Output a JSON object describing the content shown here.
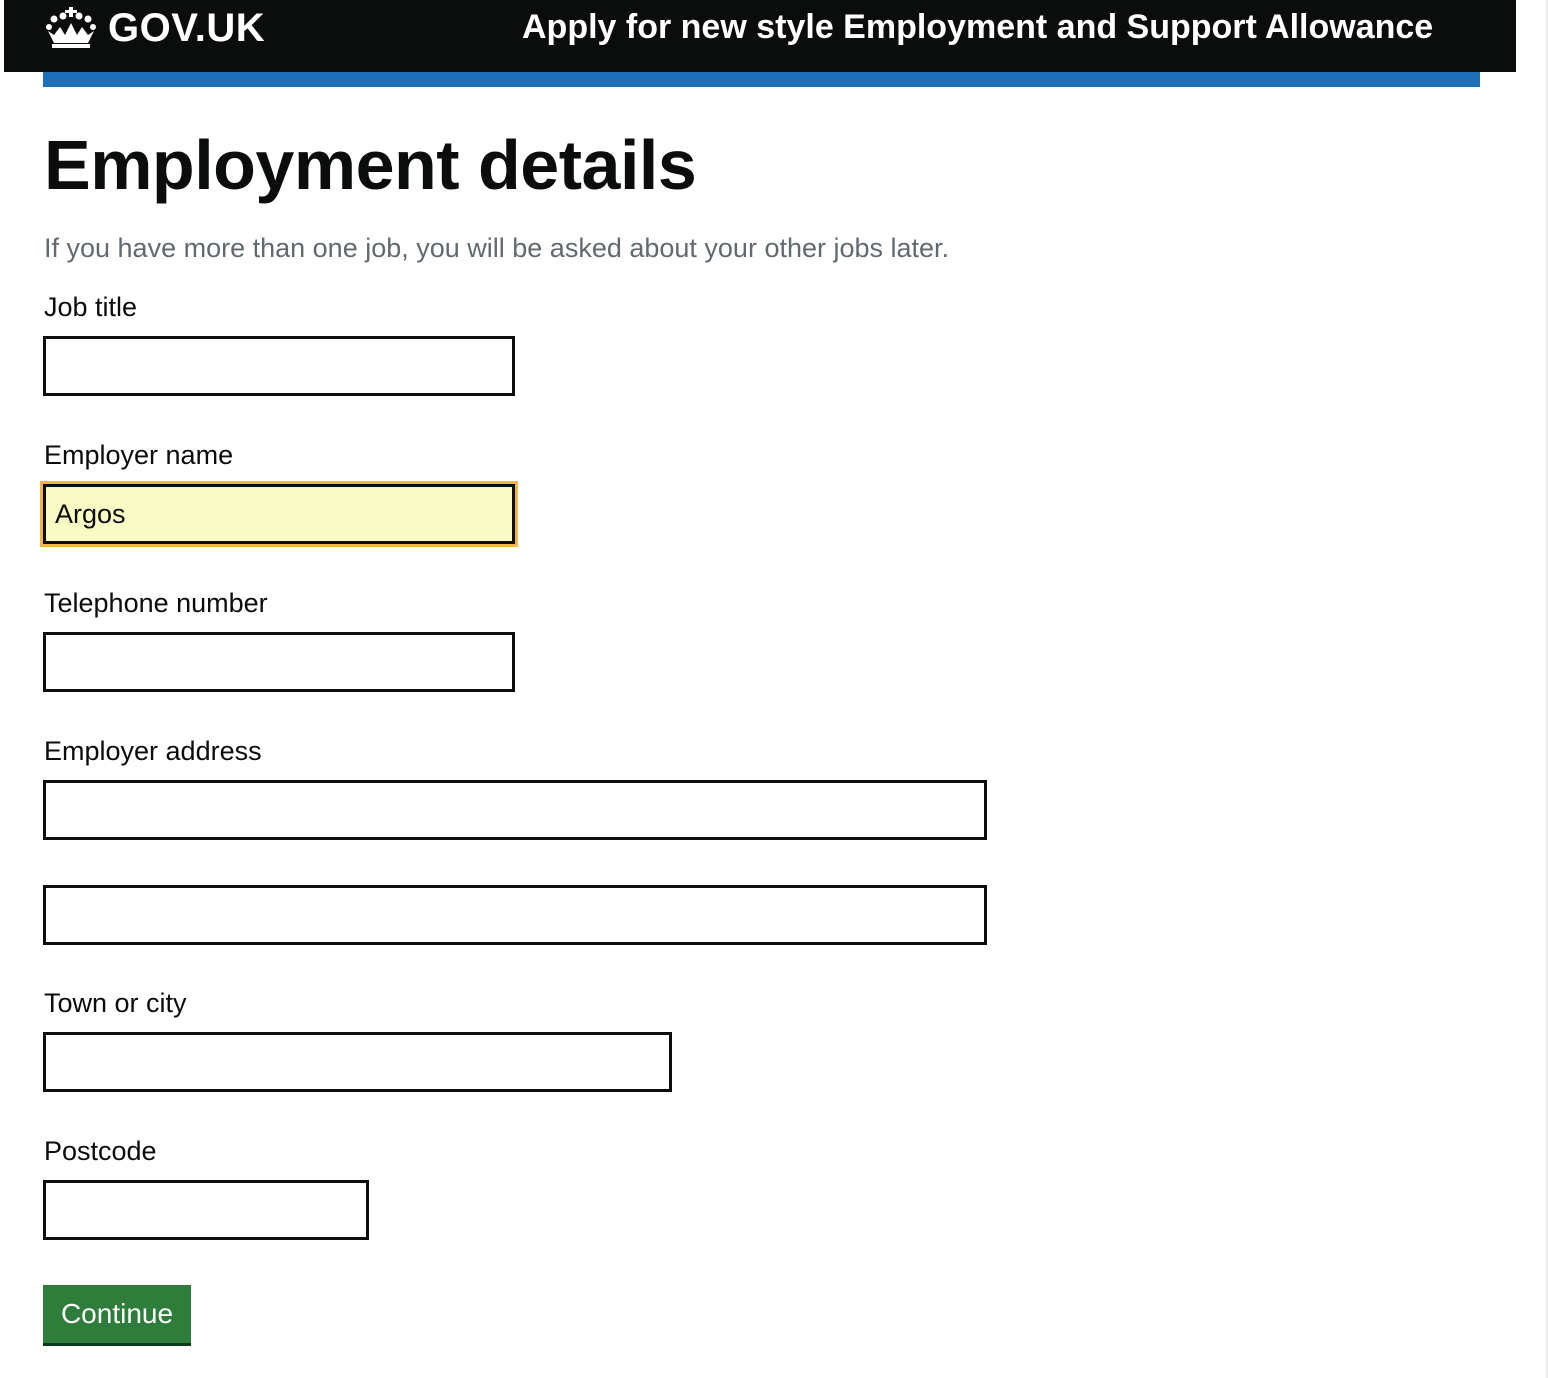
{
  "header": {
    "logo_text": "GOV.UK",
    "service_name": "Apply for new style Employment and Support Allowance"
  },
  "page": {
    "title": "Employment details",
    "hint": "If you have more than one job, you will be asked about your other jobs later."
  },
  "form": {
    "job_title": {
      "label": "Job title",
      "value": ""
    },
    "employer_name": {
      "label": "Employer name",
      "value": "Argos"
    },
    "telephone": {
      "label": "Telephone number",
      "value": ""
    },
    "employer_address": {
      "label": "Employer address",
      "line1": "",
      "line2": ""
    },
    "town": {
      "label": "Town or city",
      "value": ""
    },
    "postcode": {
      "label": "Postcode",
      "value": ""
    },
    "continue_label": "Continue"
  },
  "colors": {
    "header_bg": "#0b0c0c",
    "blue_bar": "#1d70b8",
    "focus_outline": "#f6b443",
    "focus_fill": "#f8fbc4",
    "button_green": "#2e7d3a"
  }
}
